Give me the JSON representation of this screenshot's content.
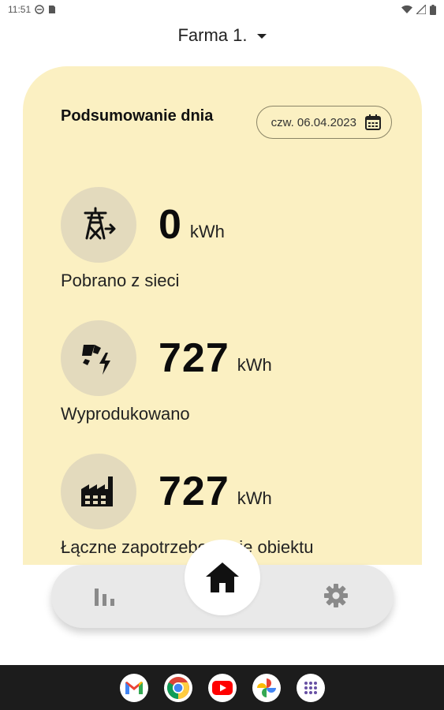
{
  "status_bar": {
    "time": "11:51"
  },
  "farm_selector": {
    "label": "Farma 1."
  },
  "card": {
    "title": "Podsumowanie dnia",
    "date": "czw. 06.04.2023",
    "background": "#fbf0c2"
  },
  "metrics": [
    {
      "value": "0",
      "unit": "kWh",
      "label": "Pobrano z sieci",
      "icon": "power-tower-icon"
    },
    {
      "value": "727",
      "unit": "kWh",
      "label": "Wyprodukowano",
      "icon": "solar-lightning-icon"
    },
    {
      "value": "727",
      "unit": "kWh",
      "label": "Łączne zapotrzebowanie obiektu",
      "icon": "factory-icon"
    }
  ],
  "bottom_nav": {
    "items": [
      {
        "name": "stats",
        "icon": "bar-chart-icon"
      },
      {
        "name": "home",
        "icon": "home-icon",
        "active": true
      },
      {
        "name": "settings",
        "icon": "gear-icon"
      }
    ]
  },
  "taskbar_apps": [
    "gmail-icon",
    "chrome-icon",
    "youtube-icon",
    "photos-icon",
    "app-drawer-icon"
  ]
}
